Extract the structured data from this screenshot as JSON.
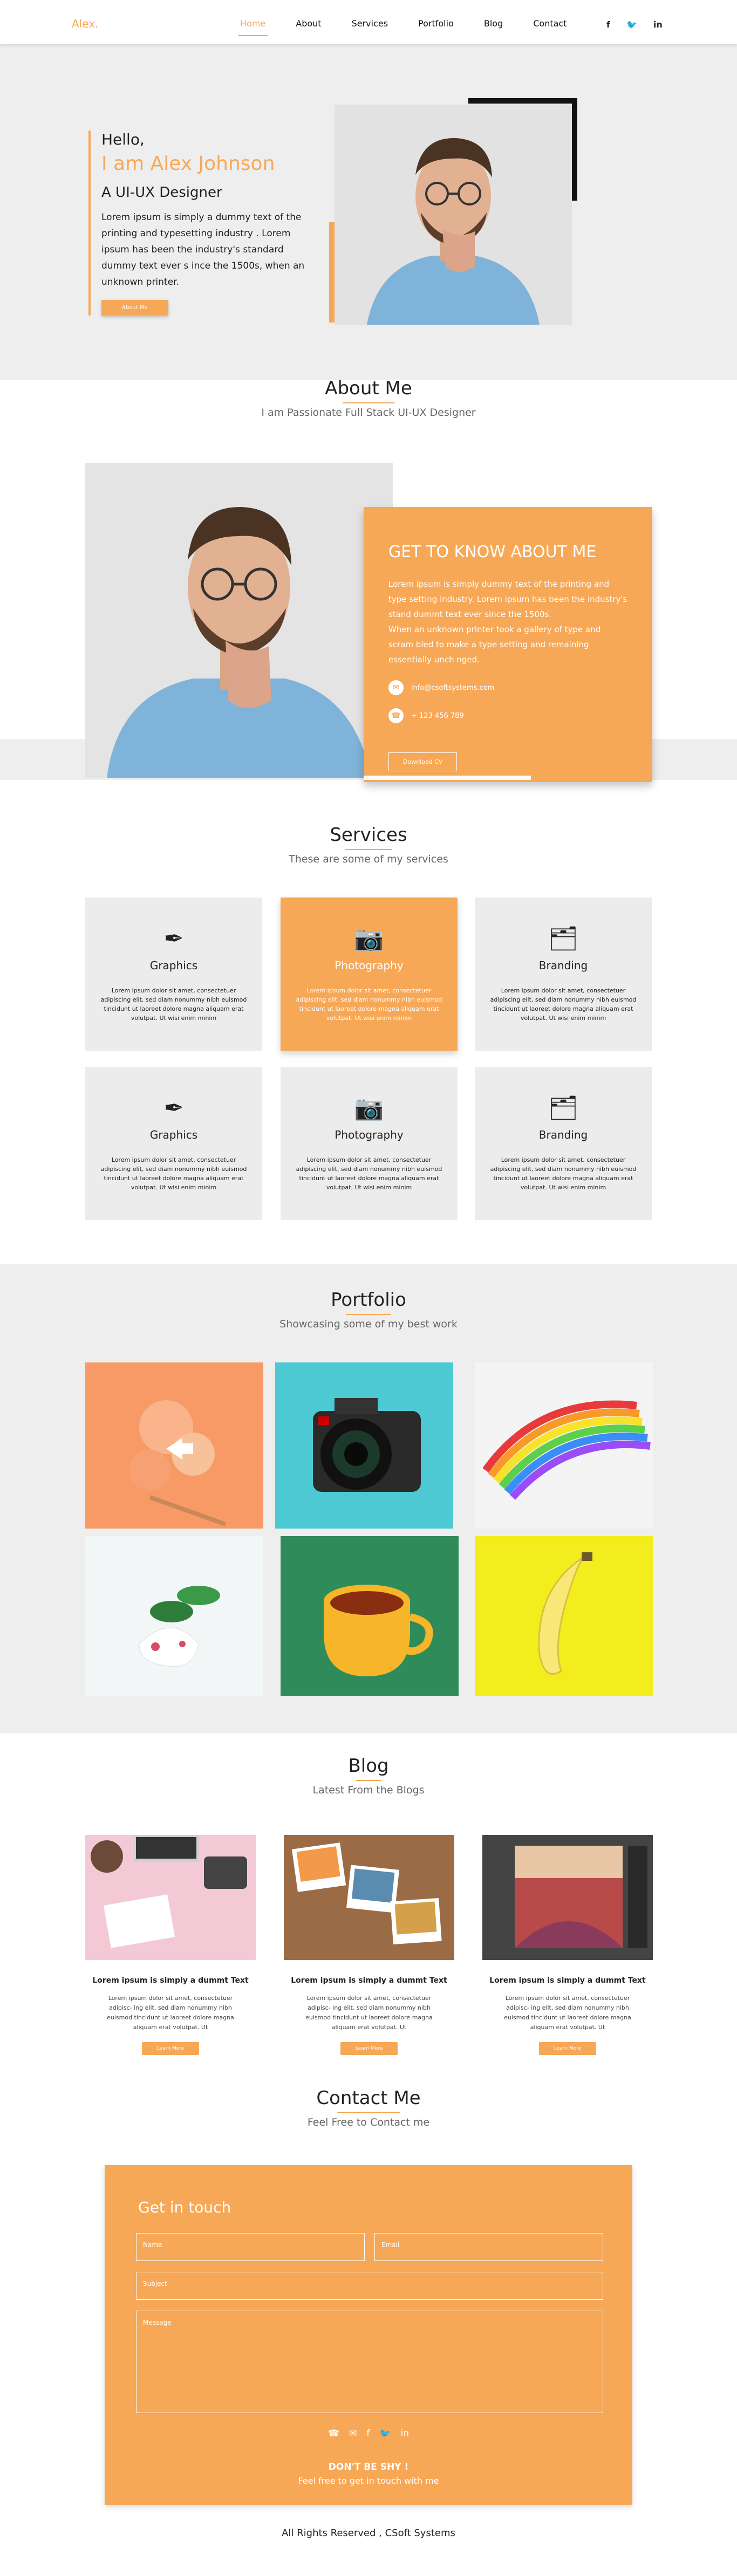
{
  "nav": {
    "logo": "Alex.",
    "items": [
      "Home",
      "About",
      "Services",
      "Portfolio",
      "Blog",
      "Contact"
    ],
    "social": [
      "f",
      "🐦",
      "in"
    ]
  },
  "hero": {
    "hello": "Hello,",
    "name": "I am Alex Johnson",
    "role": "A UI-UX Designer",
    "desc": "Lorem ipsum is simply a dummy text of the printing and typesetting industry . Lorem ipsum has been the industry's standard dummy text ever s ince the 1500s, when an unknown printer.",
    "button": "About Me"
  },
  "about": {
    "title": "About Me",
    "subtitle": "I am Passionate Full Stack UI-UX Designer",
    "card_title": "GET TO KNOW ABOUT ME",
    "p1": "Lorem ipsum is simply dummy text of the printing and type setting industry. Lorem ipsum has been the industry's stand dummt text ever since the 1500s.",
    "p2": "When an unknown printer took a gallery of type and scram bled to make a type setting and remaining essentially unch nged.",
    "email": "info@csoftsystems.com",
    "phone": "+ 123 456 789",
    "button": "Download CV"
  },
  "services": {
    "title": "Services",
    "subtitle": "These are some of my services",
    "body": "Lorem ipsum dolor sit amet, consectetuer adipiscing elit, sed diam nonummy nibh euismod tincidunt ut laoreet dolore magna aliquam erat volutpat. Ut wisi enim minim",
    "items": [
      {
        "label": "Graphics",
        "icon": "graphics-icon"
      },
      {
        "label": "Photography",
        "icon": "camera-icon"
      },
      {
        "label": "Branding",
        "icon": "branding-icon"
      },
      {
        "label": "Graphics",
        "icon": "graphics-icon"
      },
      {
        "label": "Photography",
        "icon": "camera-icon"
      },
      {
        "label": "Branding",
        "icon": "branding-icon"
      }
    ]
  },
  "portfolio": {
    "title": "Portfolio",
    "subtitle": "Showcasing some of my best work"
  },
  "blog": {
    "title": "Blog",
    "subtitle": "Latest From the Blogs",
    "posts": [
      {
        "title": "Lorem ipsum is simply a dummt Text",
        "body": "Lorem ipsum dolor sit amet, consectetuer adipisc- ing elit, sed diam nonummy nibh euismod tincidunt ut laoreet dolore magna aliquam erat volutpat. Ut",
        "button": "Learn More"
      },
      {
        "title": "Lorem ipsum is simply a dummt Text",
        "body": "Lorem ipsum dolor sit amet, consectetuer adipisc- ing elit, sed diam nonummy nibh euismod tincidunt ut laoreet dolore magna aliquam erat volutpat. Ut",
        "button": "Learn More"
      },
      {
        "title": "Lorem ipsum is simply a dummt Text",
        "body": "Lorem ipsum dolor sit amet, consectetuer adipisc- ing elit, sed diam nonummy nibh euismod tincidunt ut laoreet dolore magna aliquam erat volutpat. Ut",
        "button": "Learn More"
      }
    ]
  },
  "contact": {
    "title": "Contact Me",
    "subtitle": "Feel Free to Contact me",
    "box_title": "Get in touch",
    "name_ph": "Name",
    "email_ph": "Email",
    "subject_ph": "Subject",
    "message_ph": "Message",
    "shy": "DON'T BE SHY !",
    "shy_sub": "Feel free to get in touch with me"
  },
  "footer": {
    "text": "All Rights Reserved , CSoft Systems"
  },
  "colors": {
    "accent": "#f7a857",
    "section_bg": "#eeeeee"
  }
}
